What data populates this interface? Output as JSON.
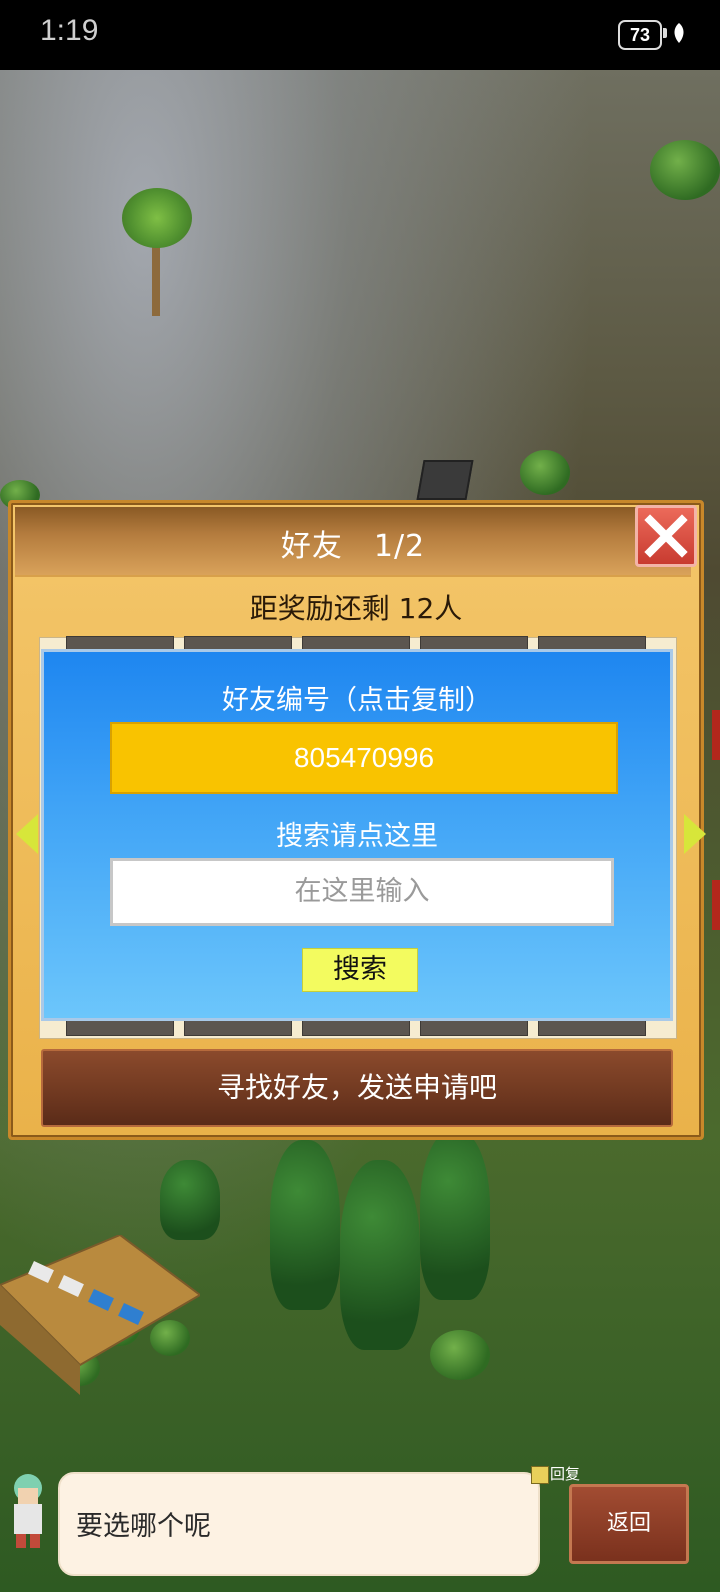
{
  "status_bar": {
    "time": "1:19",
    "battery": "73"
  },
  "dialog": {
    "title": "好友　1/2",
    "reward_text": "距奖励还剩 12人",
    "friend_id_label": "好友编号（点击复制）",
    "friend_id": "805470996",
    "search_label": "搜索请点这里",
    "search_placeholder": "在这里输入",
    "search_button": "搜索",
    "find_friends_button": "寻找好友，发送申请吧"
  },
  "bottom": {
    "speech": "要选哪个呢",
    "reply_label": "回复",
    "back_button": "返回"
  },
  "colors": {
    "dialog_gold": "#eab24a",
    "panel_blue": "#3ea2f6",
    "id_box_yellow": "#f9c300",
    "search_button_yellow": "#f3fb5f",
    "close_red": "#d84a3e",
    "find_bar_brown": "#6f3820"
  }
}
